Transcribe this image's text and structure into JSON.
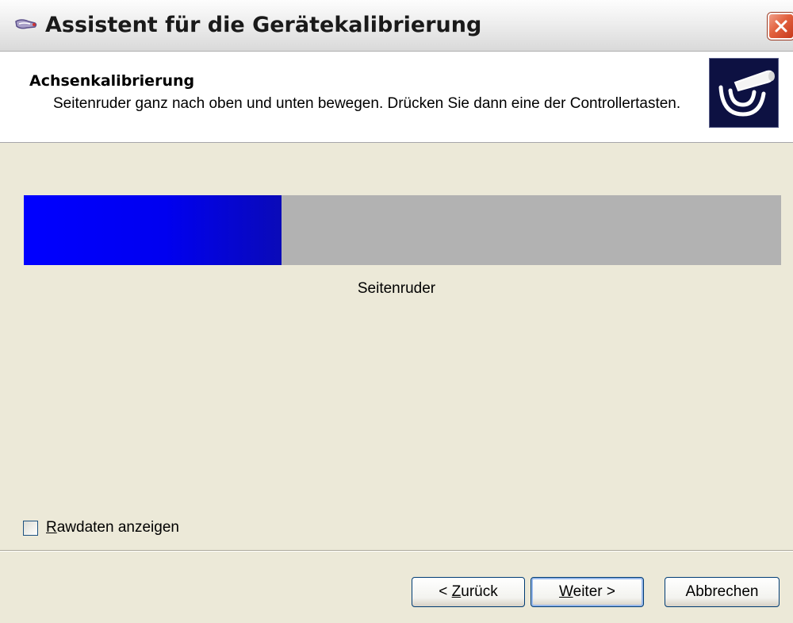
{
  "window": {
    "title": "Assistent für die Gerätekalibrierung",
    "app_icon": "joystick-icon",
    "close_icon": "close-icon"
  },
  "header": {
    "step_title": "Achsenkalibrierung",
    "instruction": "Seitenruder ganz nach oben und unten bewegen. Drücken Sie dann eine der Controllertasten.",
    "image_icon": "calibration-joystick-icon"
  },
  "axis": {
    "label": "Seitenruder",
    "fill_fraction": 0.34,
    "fill_color": "#0000ff",
    "track_color": "#b2b2b2"
  },
  "raw_data": {
    "mnemonic": "R",
    "label_rest": "awdaten anzeigen",
    "checked": false
  },
  "buttons": {
    "back_prefix": "< ",
    "back_mnemonic": "Z",
    "back_rest": "urück",
    "next_mnemonic": "W",
    "next_rest": "eiter >",
    "cancel": "Abbrechen"
  }
}
